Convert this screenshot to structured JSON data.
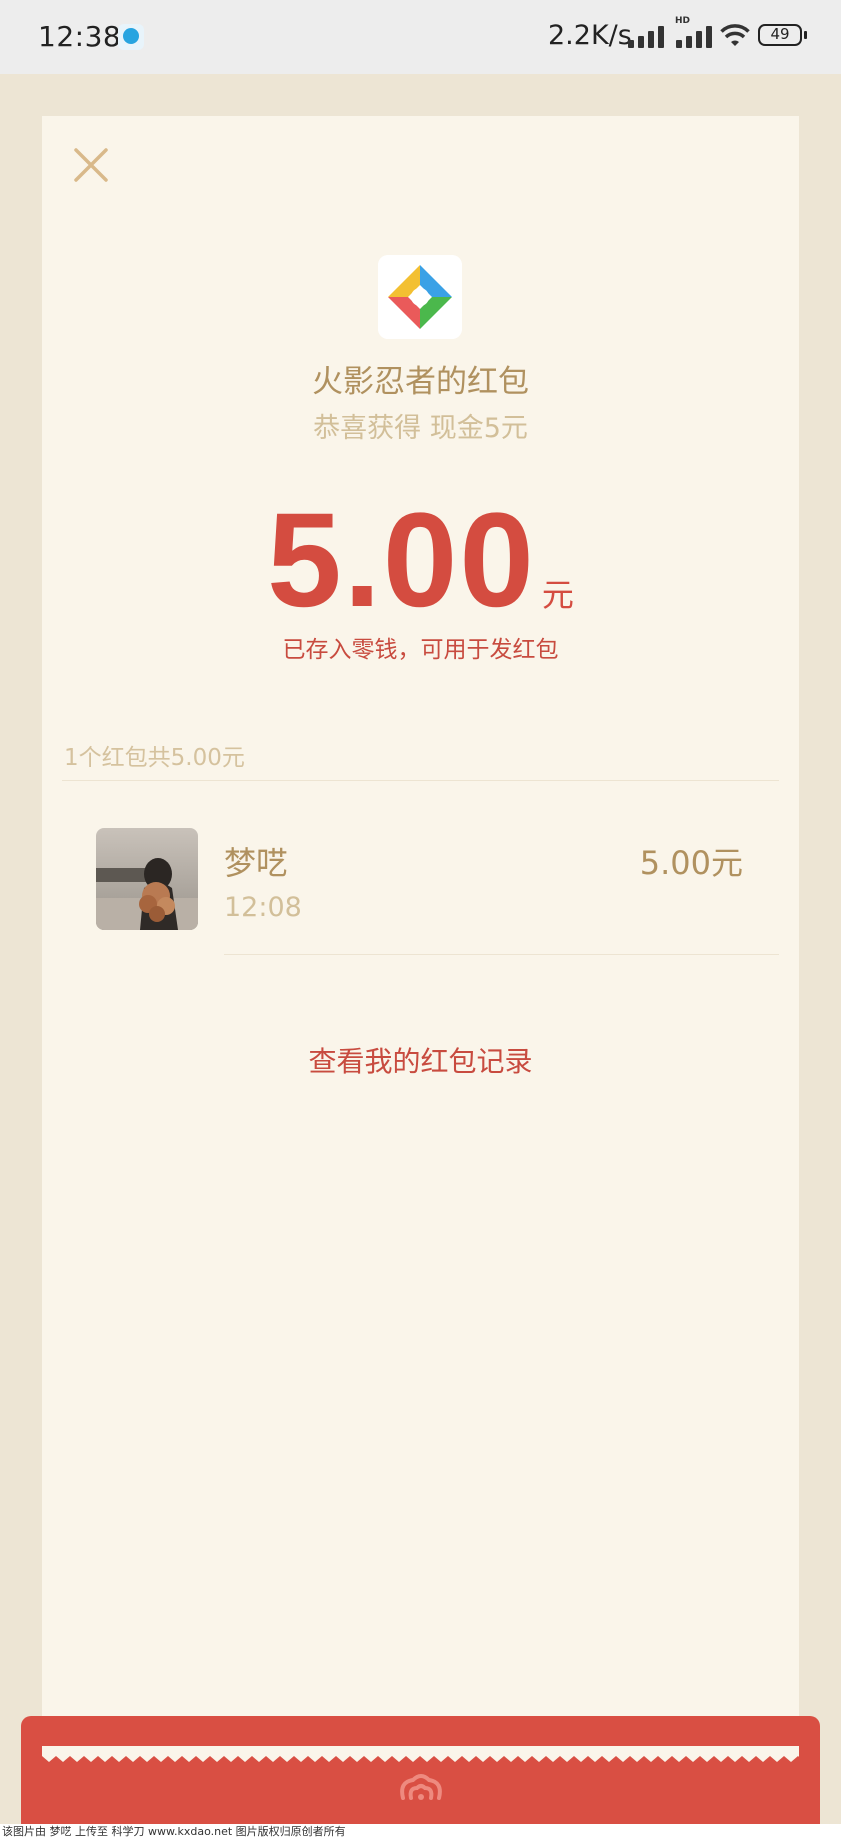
{
  "status_bar": {
    "time": "12:38",
    "network_speed": "2.2K/s",
    "hd_label": "HD",
    "battery": "49"
  },
  "red_packet": {
    "sender_title": "火影忍者的红包",
    "greeting": "恭喜获得 现金5元",
    "amount": "5.00",
    "amount_unit": "元",
    "stored_note": "已存入零钱，可用于发红包",
    "summary": "1个红包共5.00元",
    "records": [
      {
        "name": "梦呓",
        "time": "12:08",
        "amount": "5.00元"
      }
    ],
    "records_link": "查看我的红包记录"
  },
  "watermark": "该图片由 梦呓 上传至 科学刀 www.kxdao.net 图片版权归原创者所有",
  "colors": {
    "accent_red": "#d44c40",
    "gold_text": "#b0915f",
    "card_bg": "#faf5ea",
    "page_bg": "#ede5d4"
  }
}
